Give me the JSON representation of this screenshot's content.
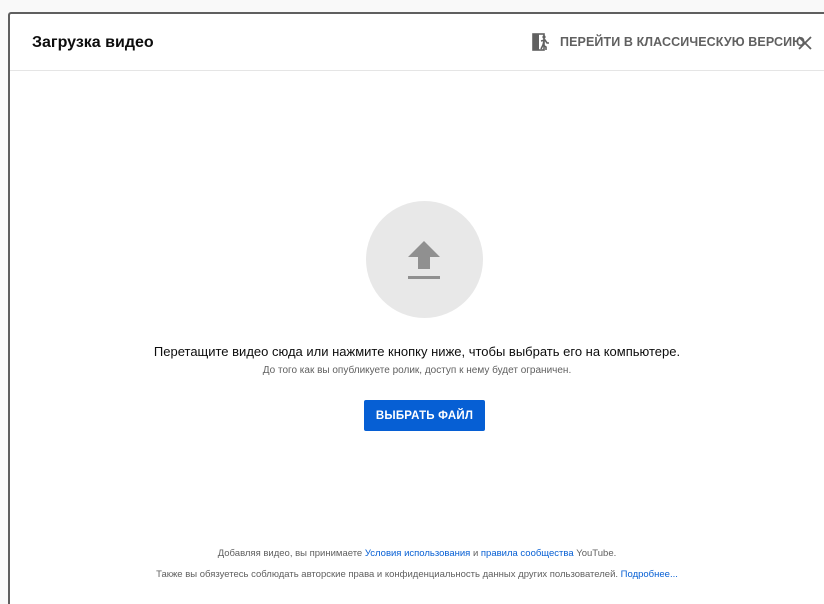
{
  "dialog": {
    "title": "Загрузка видео",
    "classic_link_label": "ПЕРЕЙТИ В КЛАССИЧЕСКУЮ ВЕРСИЮ",
    "close_icon": "close-icon"
  },
  "upload": {
    "icon": "upload-arrow-icon",
    "main_text": "Перетащите видео сюда или нажмите кнопку ниже, чтобы выбрать его на компьютере.",
    "sub_text": "До того как вы опубликуете ролик, доступ к нему будет ограничен.",
    "button_label": "ВЫБРАТЬ ФАЙЛ"
  },
  "footer": {
    "line1_prefix": "Добавляя видео, вы принимаете ",
    "terms_link": "Условия использования",
    "line1_middle": " и ",
    "community_link": "правила сообщества",
    "line1_suffix": " YouTube.",
    "line2_text": "Также вы обязуетесь соблюдать авторские права и конфиденциальность данных других пользователей. ",
    "more_link": "Подробнее..."
  },
  "colors": {
    "accent": "#065fd4",
    "text_primary": "#0d0d0d",
    "text_secondary": "#606060",
    "circle_bg": "#e8e8e8",
    "icon_gray": "#909090"
  }
}
